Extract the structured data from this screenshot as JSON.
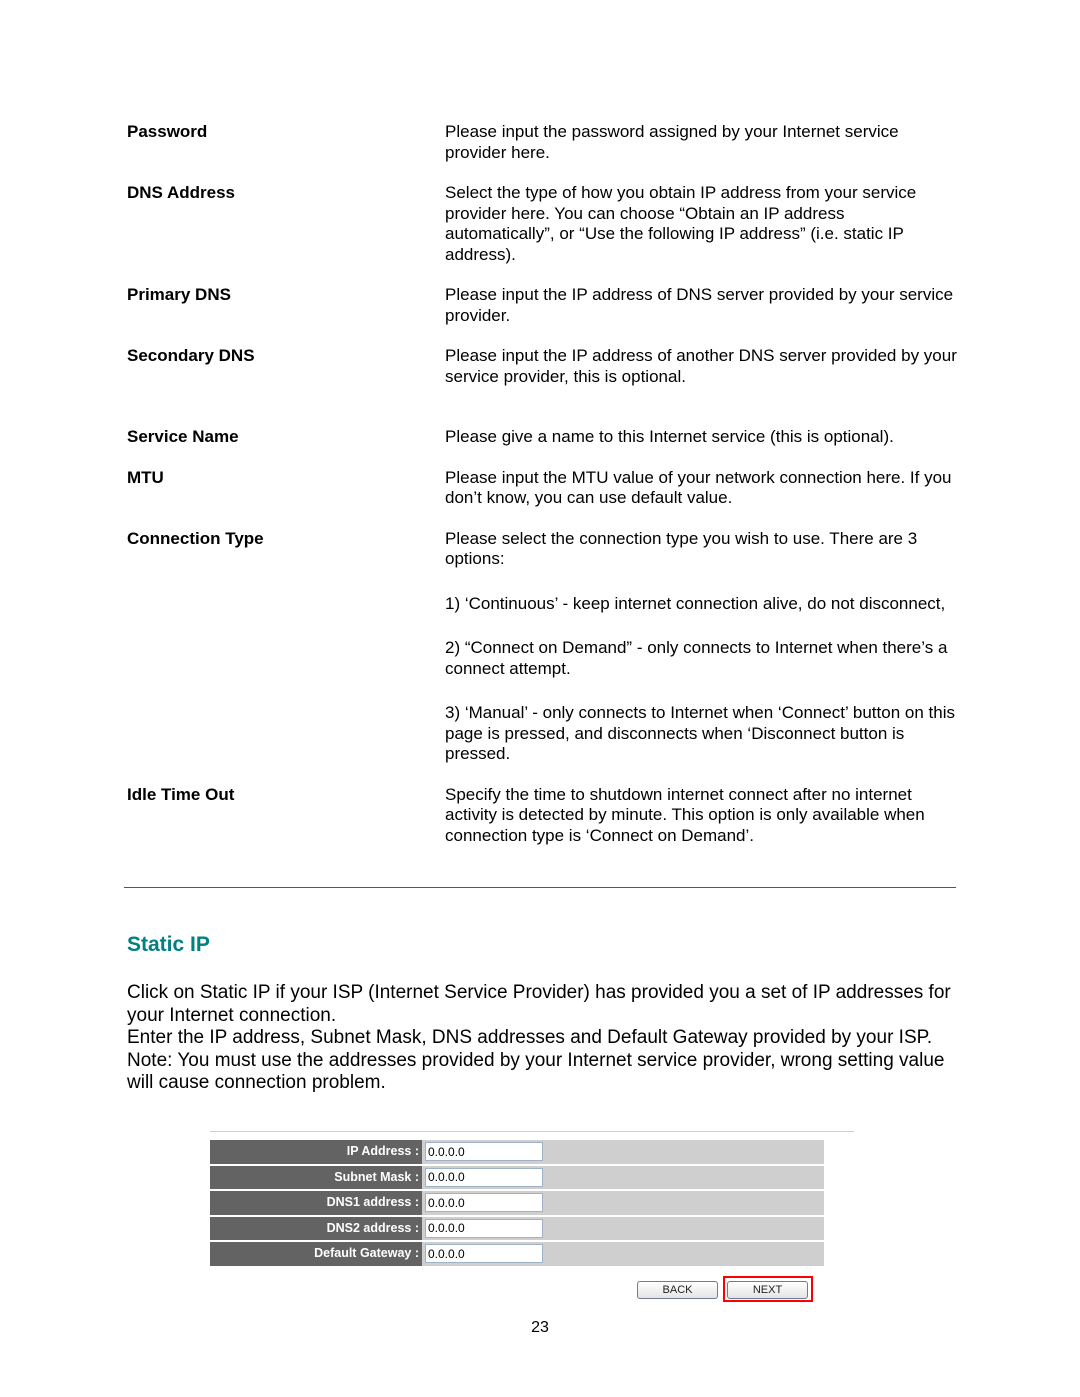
{
  "definitions": [
    {
      "term": "Password",
      "paragraphs": [
        "Please input the password assigned by your Internet service provider here."
      ]
    },
    {
      "term": "DNS Address",
      "paragraphs": [
        "Select the type of how you obtain IP address from your service provider here. You can choose “Obtain an IP address automatically”, or “Use the following IP address” (i.e. static IP address)."
      ]
    },
    {
      "term": "Primary DNS",
      "paragraphs": [
        "Please input the IP address of DNS server provided by your service provider."
      ]
    },
    {
      "term": "Secondary DNS",
      "paragraphs": [
        "Please input the IP address of another DNS server provided by your service provider, this is optional."
      ]
    },
    {
      "term": "Service Name",
      "paragraphs": [
        "Please give a name to this Internet service (this is optional)."
      ]
    },
    {
      "term": "MTU",
      "paragraphs": [
        "Please input the MTU value of your network connection here. If you don’t know, you can use default value."
      ]
    },
    {
      "term": "Connection Type",
      "paragraphs": [
        "Please select the connection type you wish to use. There are 3 options:",
        "1) ‘Continuous’ - keep internet connection alive, do not disconnect,",
        "2) “Connect on Demand” - only connects to Internet when there’s a connect attempt.",
        "3) ‘Manual’ - only connects to Internet when ‘Connect’ button on this page is pressed, and disconnects when ‘Disconnect button is pressed."
      ]
    },
    {
      "term": "Idle Time Out",
      "paragraphs": [
        "Specify the time to shutdown internet connect after no internet activity is detected by minute. This option is only available when connection type is ‘Connect on Demand’."
      ]
    }
  ],
  "section": {
    "title": "Static IP",
    "title_color": "#008080",
    "intro": [
      "Click on Static IP if your ISP (Internet Service Provider) has provided you a set of IP addresses for your Internet connection.",
      "Enter the IP address, Subnet Mask, DNS addresses and Default Gateway provided by your ISP.",
      "Note: You must use the addresses provided by your Internet service provider, wrong setting value will cause connection problem."
    ]
  },
  "form": {
    "fields": [
      {
        "label": "IP Address :",
        "value": "0.0.0.0"
      },
      {
        "label": "Subnet Mask :",
        "value": "0.0.0.0"
      },
      {
        "label": "DNS1 address :",
        "value": "0.0.0.0"
      },
      {
        "label": "DNS2 address :",
        "value": "0.0.0.0"
      },
      {
        "label": "Default Gateway :",
        "value": "0.0.0.0"
      }
    ],
    "back_label": "BACK",
    "next_label": "NEXT",
    "highlight_color": "#ff0000"
  },
  "page_number": "23"
}
